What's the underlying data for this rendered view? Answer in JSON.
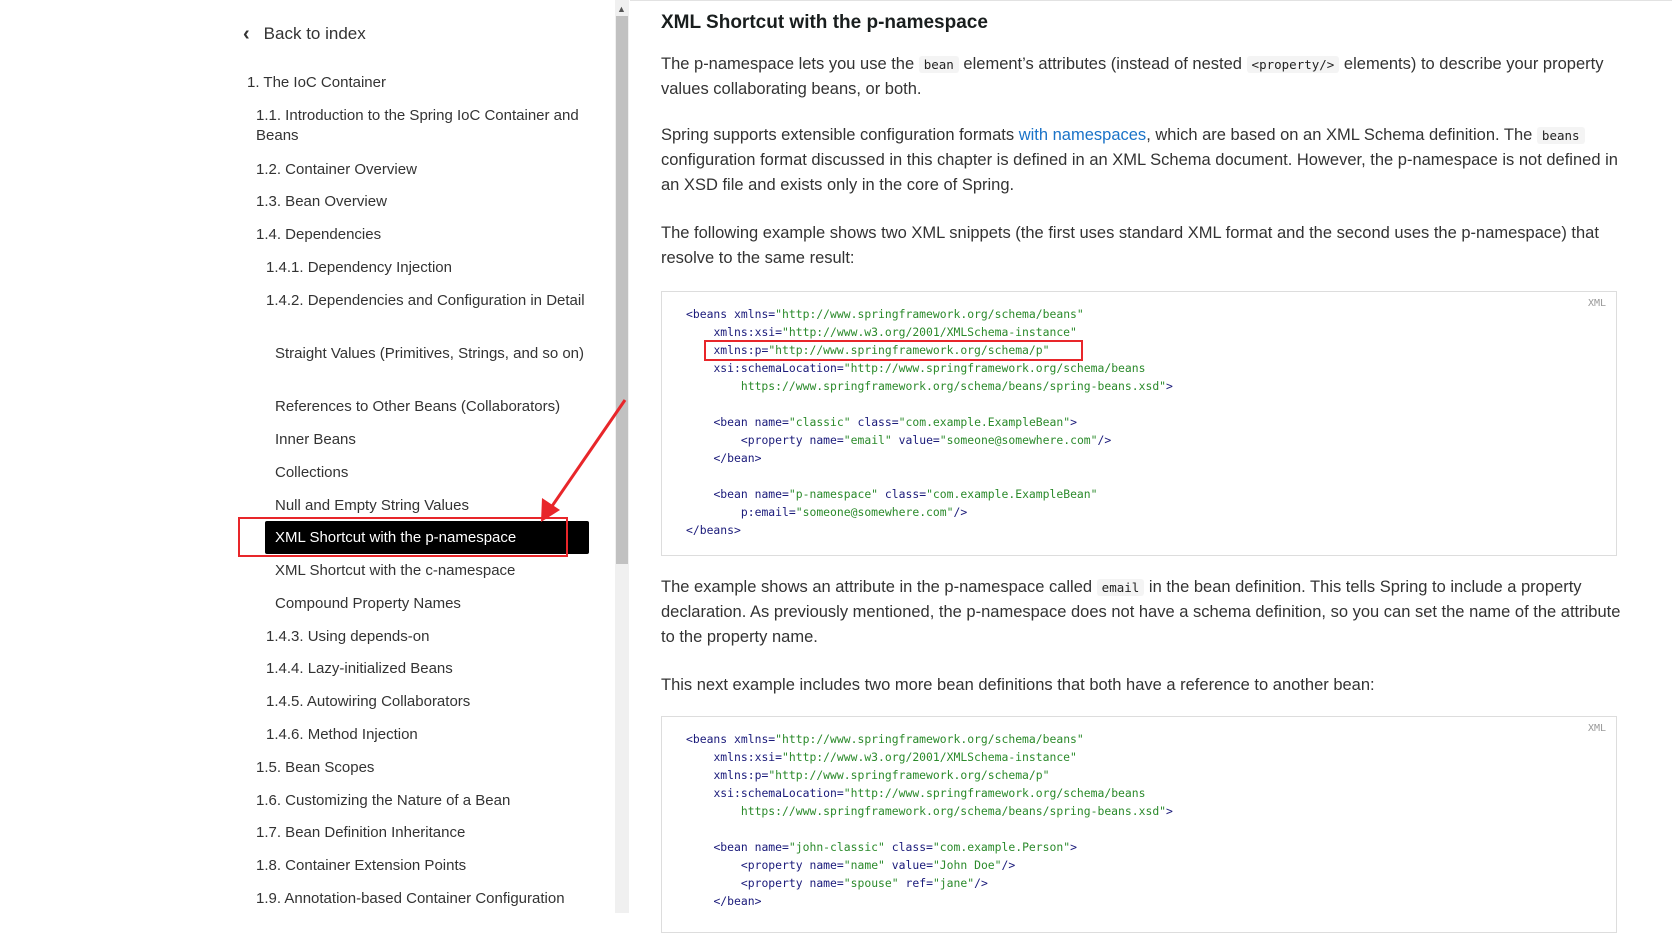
{
  "sidebar": {
    "back_label": "Back to index",
    "items": [
      {
        "label": "1. The IoC Container"
      },
      {
        "label": "1.1. Introduction to the Spring IoC Container and Beans"
      },
      {
        "label": "1.2. Container Overview"
      },
      {
        "label": "1.3. Bean Overview"
      },
      {
        "label": "1.4. Dependencies"
      },
      {
        "label": "1.4.1. Dependency Injection"
      },
      {
        "label": "1.4.2. Dependencies and Configuration in Detail"
      },
      {
        "label": "Straight Values (Primitives, Strings, and so on)"
      },
      {
        "label": "References to Other Beans (Collaborators)"
      },
      {
        "label": "Inner Beans"
      },
      {
        "label": "Collections"
      },
      {
        "label": "Null and Empty String Values"
      },
      {
        "label": "XML Shortcut with the p-namespace"
      },
      {
        "label": "XML Shortcut with the c-namespace"
      },
      {
        "label": "Compound Property Names"
      },
      {
        "label": "1.4.3. Using depends-on"
      },
      {
        "label": "1.4.4. Lazy-initialized Beans"
      },
      {
        "label": "1.4.5. Autowiring Collaborators"
      },
      {
        "label": "1.4.6. Method Injection"
      },
      {
        "label": "1.5. Bean Scopes"
      },
      {
        "label": "1.6. Customizing the Nature of a Bean"
      },
      {
        "label": "1.7. Bean Definition Inheritance"
      },
      {
        "label": "1.8. Container Extension Points"
      },
      {
        "label": "1.9. Annotation-based Container Configuration"
      }
    ]
  },
  "main": {
    "title": "XML Shortcut with the p-namespace",
    "p1": {
      "t1": "The p-namespace lets you use the ",
      "c1": "bean",
      "t2": " element’s attributes (instead of nested ",
      "c2": "<property/>",
      "t3": " elements) to describe your property values collaborating beans, or both."
    },
    "p2": {
      "t1": "Spring supports extensible configuration formats ",
      "link": "with namespaces",
      "t2": ", which are based on an XML Schema definition. The ",
      "c1": "beans",
      "t3": " configuration format discussed in this chapter is defined in an XML Schema document. However, the p-namespace is not defined in an XSD file and exists only in the core of Spring."
    },
    "p3": "The following example shows two XML snippets (the first uses standard XML format and the second uses the p-namespace) that resolve to the same result:",
    "code1_lang": "XML",
    "p4": {
      "t1": "The example shows an attribute in the p-namespace called ",
      "c1": "email",
      "t2": " in the bean definition. This tells Spring to include a property declaration. As previously mentioned, the p-namespace does not have a schema definition, so you can set the name of the attribute to the property name."
    },
    "p5": "This next example includes two more bean definitions that both have a reference to another bean:",
    "code2_lang": "XML"
  },
  "colors": {
    "active_bg": "#000000",
    "highlight_red": "#e8262a",
    "link": "#1a73c8",
    "string": "#2b8a2b"
  }
}
